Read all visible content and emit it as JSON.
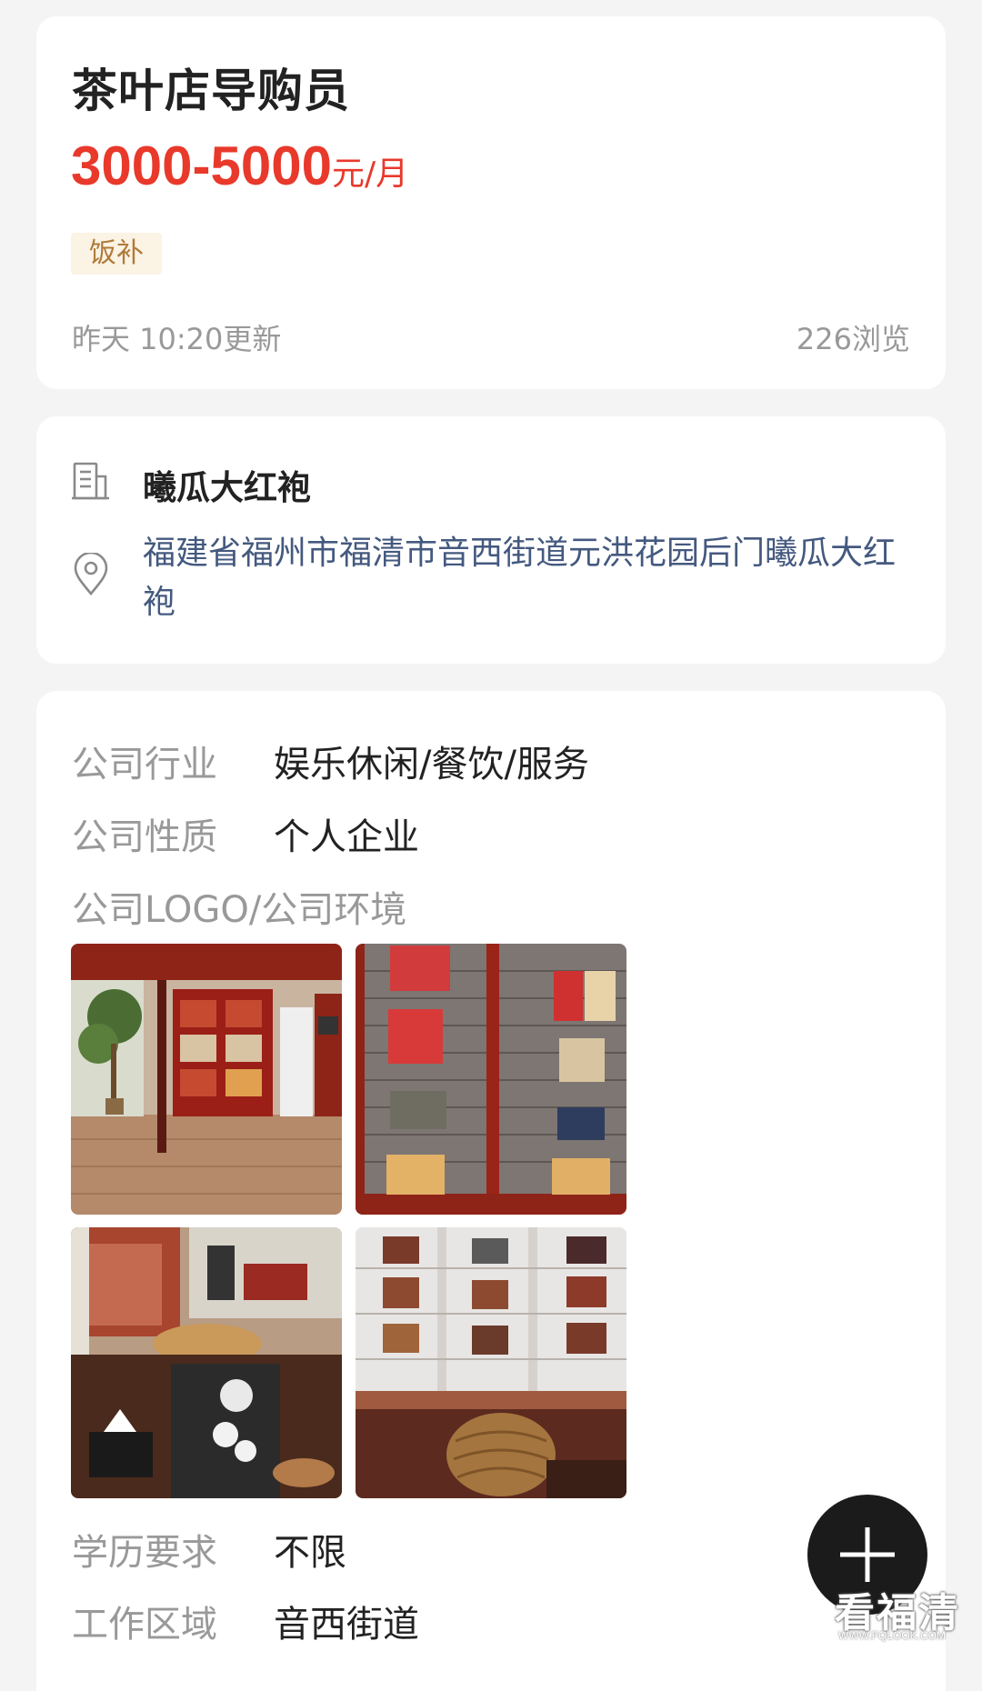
{
  "job": {
    "title": "茶叶店导购员",
    "salary_amount": "3000-5000",
    "salary_unit": "元/月",
    "tags": [
      "饭补"
    ],
    "updated": "昨天 10:20更新",
    "views": "226浏览"
  },
  "company": {
    "name": "曦瓜大红袍",
    "address": "福建省福州市福清市音西街道元洪花园后门曦瓜大红袍",
    "icons": {
      "company": "building-icon",
      "location": "location-pin-icon"
    }
  },
  "details": {
    "industry_label": "公司行业",
    "industry_value": "娱乐休闲/餐饮/服务",
    "nature_label": "公司性质",
    "nature_value": "个人企业",
    "gallery_label": "公司LOGO/公司环境",
    "photos": [
      "store-interior-photo",
      "tea-boxes-wall-photo",
      "tea-table-photo",
      "display-cabinet-photo"
    ],
    "education_label": "学历要求",
    "education_value": "不限",
    "area_label": "工作区域",
    "area_value": "音西街道"
  },
  "fab": {
    "icon": "plus-icon"
  },
  "watermark": {
    "text": "看福清",
    "url": "WWW.FQLOOK.COM"
  },
  "colors": {
    "salary": "#e8392b",
    "tag_bg": "#fbf3e4",
    "tag_text": "#b07a3a",
    "address": "#44597f",
    "fab_bg": "#1b1b1b"
  }
}
